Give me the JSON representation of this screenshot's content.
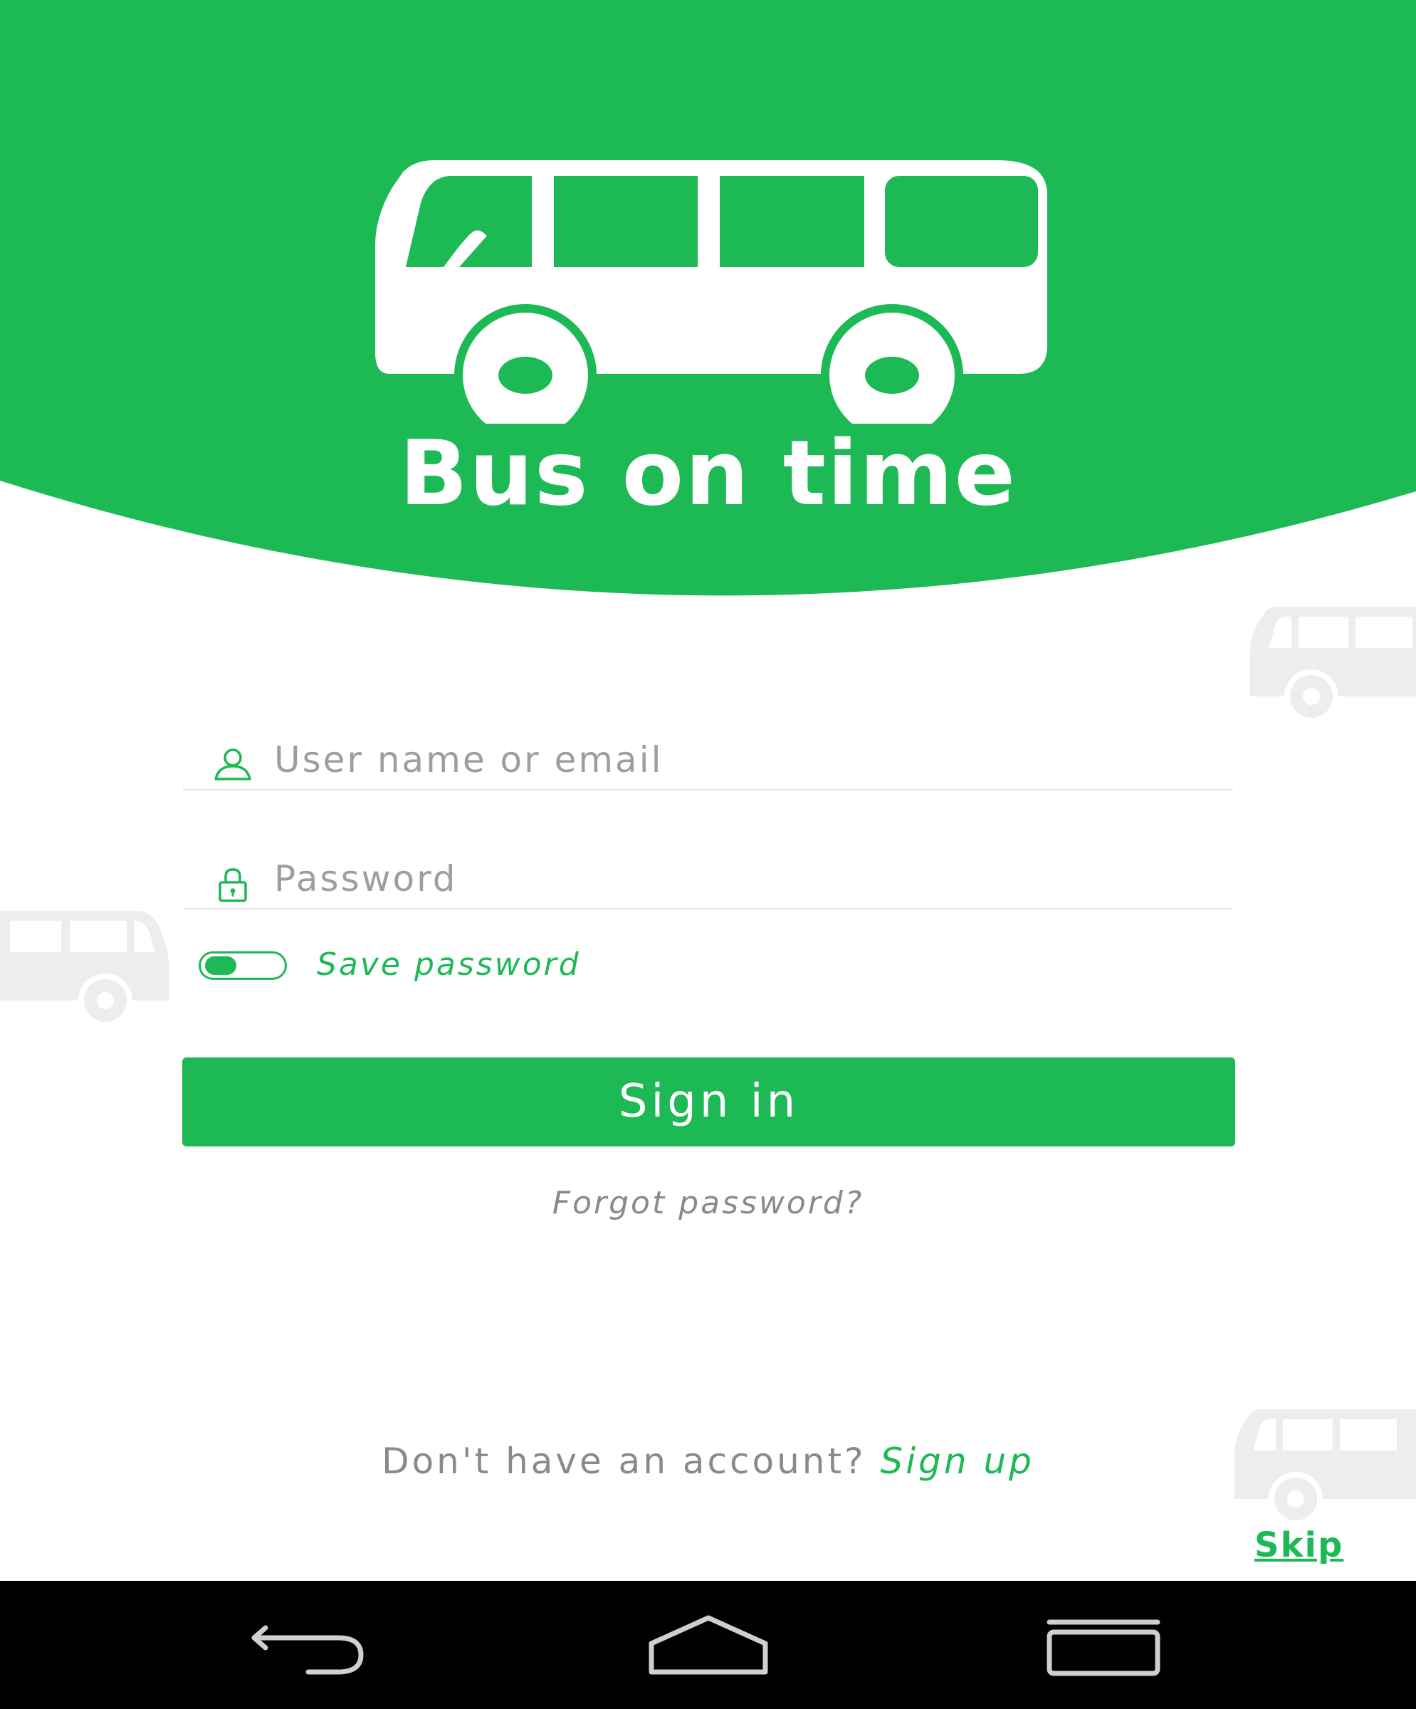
{
  "app": {
    "title": "Bus on time",
    "accent_color": "#1db954",
    "logo_icon": "bus-icon"
  },
  "form": {
    "username": {
      "placeholder": "User name or email",
      "value": "",
      "icon": "user-icon"
    },
    "password": {
      "placeholder": "Password",
      "value": "",
      "icon": "lock-icon"
    },
    "save_password": {
      "label": "Save password",
      "enabled": false
    },
    "signin_label": "Sign in",
    "forgot_label": "Forgot password?"
  },
  "footer": {
    "signup_prompt": "Don't have an account? ",
    "signup_link": "Sign up",
    "skip_label": "Skip"
  },
  "nav": {
    "back_icon": "back-icon",
    "home_icon": "home-icon",
    "recents_icon": "recent-apps-icon"
  }
}
